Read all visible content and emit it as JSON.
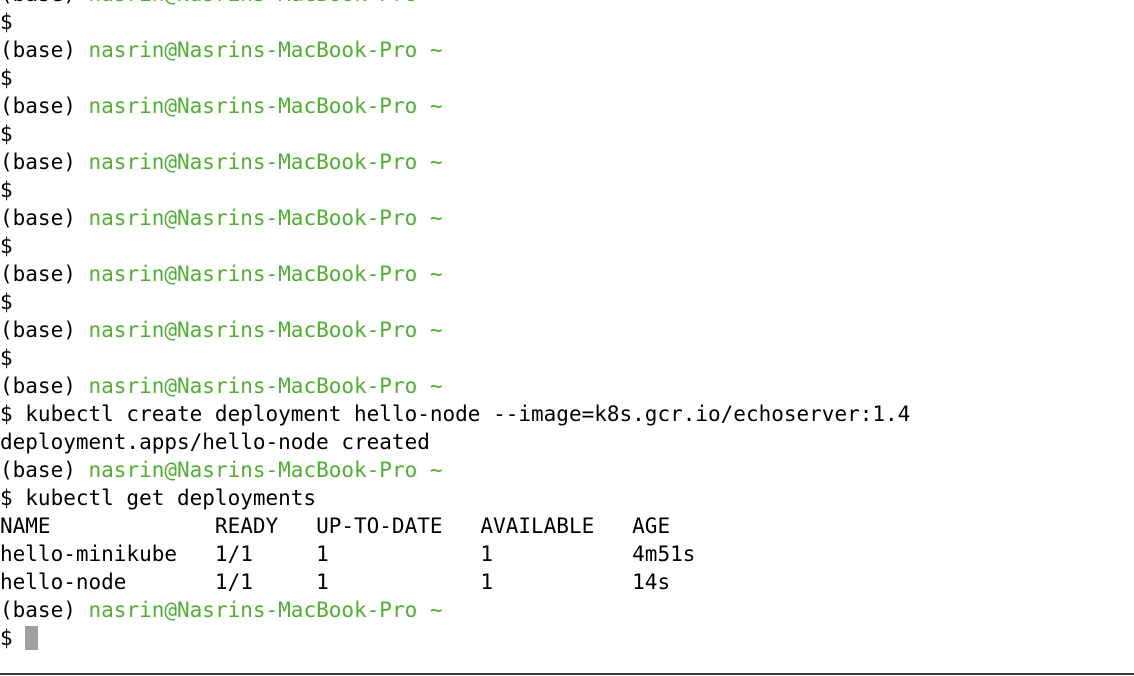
{
  "terminal": {
    "lines": [
      {
        "kind": "prompt",
        "env": "(base) ",
        "host": "nasrin@Nasrins-MacBook-Pro ~"
      },
      {
        "kind": "command",
        "text": "$"
      },
      {
        "kind": "prompt",
        "env": "(base) ",
        "host": "nasrin@Nasrins-MacBook-Pro ~"
      },
      {
        "kind": "command",
        "text": "$"
      },
      {
        "kind": "prompt",
        "env": "(base) ",
        "host": "nasrin@Nasrins-MacBook-Pro ~"
      },
      {
        "kind": "command",
        "text": "$"
      },
      {
        "kind": "prompt",
        "env": "(base) ",
        "host": "nasrin@Nasrins-MacBook-Pro ~"
      },
      {
        "kind": "command",
        "text": "$"
      },
      {
        "kind": "prompt",
        "env": "(base) ",
        "host": "nasrin@Nasrins-MacBook-Pro ~"
      },
      {
        "kind": "command",
        "text": "$"
      },
      {
        "kind": "prompt",
        "env": "(base) ",
        "host": "nasrin@Nasrins-MacBook-Pro ~"
      },
      {
        "kind": "command",
        "text": "$"
      },
      {
        "kind": "prompt",
        "env": "(base) ",
        "host": "nasrin@Nasrins-MacBook-Pro ~"
      },
      {
        "kind": "command",
        "text": "$"
      },
      {
        "kind": "prompt",
        "env": "(base) ",
        "host": "nasrin@Nasrins-MacBook-Pro ~"
      },
      {
        "kind": "command",
        "text": "$ kubectl create deployment hello-node --image=k8s.gcr.io/echoserver:1.4"
      },
      {
        "kind": "output",
        "text": "deployment.apps/hello-node created"
      },
      {
        "kind": "prompt",
        "env": "(base) ",
        "host": "nasrin@Nasrins-MacBook-Pro ~"
      },
      {
        "kind": "command",
        "text": "$ kubectl get deployments"
      },
      {
        "kind": "output",
        "text": "NAME             READY   UP-TO-DATE   AVAILABLE   AGE"
      },
      {
        "kind": "output",
        "text": "hello-minikube   1/1     1            1           4m51s"
      },
      {
        "kind": "output",
        "text": "hello-node       1/1     1            1           14s"
      },
      {
        "kind": "prompt",
        "env": "(base) ",
        "host": "nasrin@Nasrins-MacBook-Pro ~"
      },
      {
        "kind": "input",
        "text": "$ "
      }
    ]
  },
  "colors": {
    "background": "#ffffff",
    "text": "#000000",
    "host": "#4faf32",
    "cursor": "#a0a0a0"
  }
}
